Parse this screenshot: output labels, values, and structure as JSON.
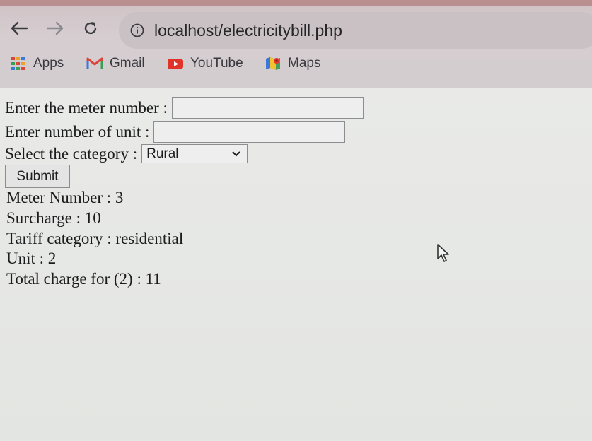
{
  "browser": {
    "url": "localhost/electricitybill.php",
    "bookmarks": [
      {
        "label": "Apps",
        "icon": "apps-grid-icon"
      },
      {
        "label": "Gmail",
        "icon": "gmail-icon"
      },
      {
        "label": "YouTube",
        "icon": "youtube-icon"
      },
      {
        "label": "Maps",
        "icon": "maps-icon"
      }
    ]
  },
  "form": {
    "meter_label": "Enter the meter number :",
    "meter_value": "",
    "unit_label": "Enter number of unit :",
    "unit_value": "",
    "category_label": "Select the category :",
    "category_value": "Rural",
    "submit_label": "Submit"
  },
  "result": {
    "meter_number": "Meter Number : 3",
    "surcharge": "Surcharge : 10",
    "tariff_category": "Tariff category : residential",
    "unit": "Unit : 2",
    "total_charge": "Total charge for (2) : 11"
  }
}
